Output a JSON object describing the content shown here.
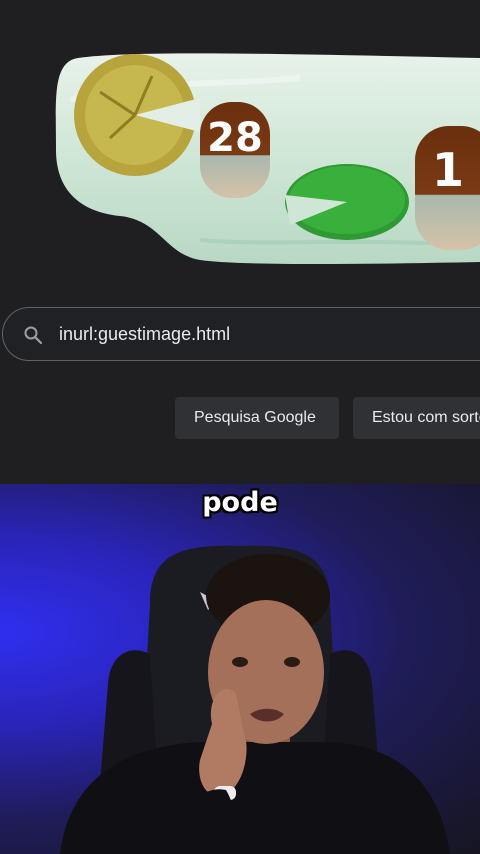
{
  "search": {
    "query": "inurl:guestimage.html"
  },
  "buttons": {
    "search_label": "Pesquisa Google",
    "lucky_label": "Estou com sorte"
  },
  "doodle": {
    "text_a": "28",
    "text_b": "1"
  },
  "caption": {
    "text": "pode"
  },
  "icons": {
    "search": "search-icon"
  },
  "colors": {
    "page_background": "#1f1f21",
    "button_background": "#303134",
    "webcam_light": "#2f2ff0"
  }
}
